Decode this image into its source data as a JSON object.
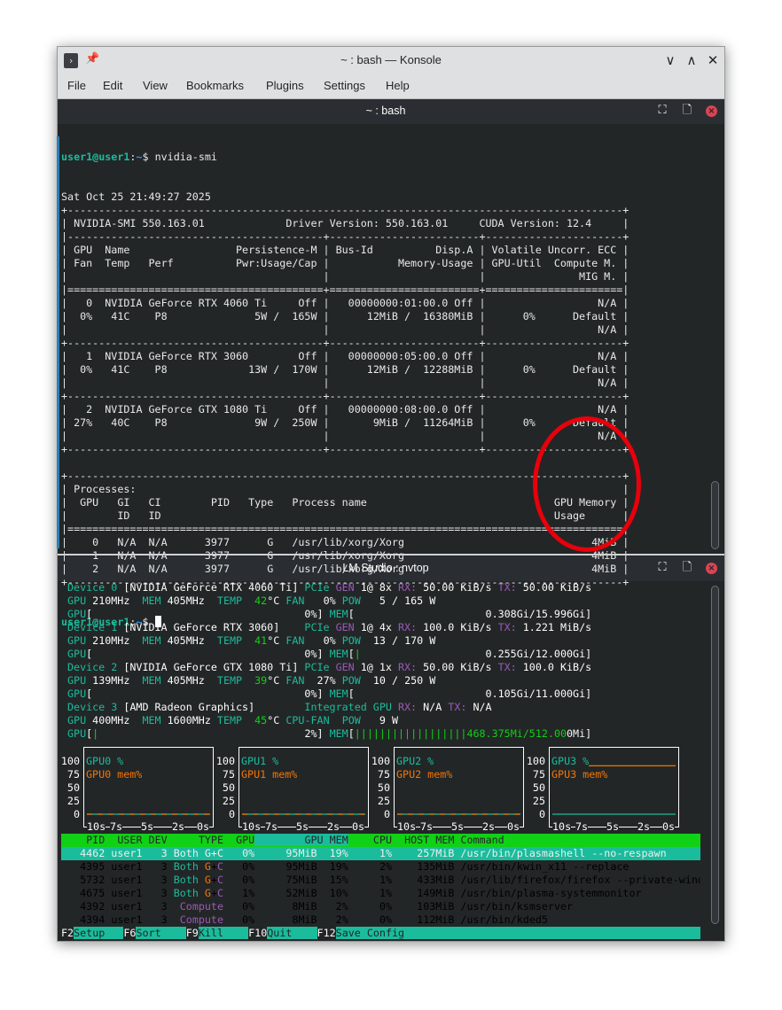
{
  "window": {
    "title": "~ : bash — Konsole",
    "app_icon": "terminal-icon",
    "buttons": [
      "minimize",
      "maximize",
      "close"
    ]
  },
  "menu": [
    "File",
    "Edit",
    "View",
    "Bookmarks",
    "Plugins",
    "Settings",
    "Help"
  ],
  "top_pane": {
    "title": "~ : bash",
    "prompt": {
      "user_host": "user1@user1",
      "sep": ":",
      "path": "~",
      "symbol": "$ ",
      "command": "nvidia-smi"
    },
    "output_lines": [
      "Sat Oct 25 21:49:27 2025",
      "+-----------------------------------------------------------------------------------------+",
      "| NVIDIA-SMI 550.163.01             Driver Version: 550.163.01     CUDA Version: 12.4     |",
      "|-----------------------------------------+------------------------+----------------------+",
      "| GPU  Name                 Persistence-M | Bus-Id          Disp.A | Volatile Uncorr. ECC |",
      "| Fan  Temp   Perf          Pwr:Usage/Cap |           Memory-Usage | GPU-Util  Compute M. |",
      "|                                         |                        |               MIG M. |",
      "|=========================================+========================+======================|",
      "|   0  NVIDIA GeForce RTX 4060 Ti     Off |   00000000:01:00.0 Off |                  N/A |",
      "|  0%   41C    P8              5W /  165W |      12MiB /  16380MiB |      0%      Default |",
      "|                                         |                        |                  N/A |",
      "+-----------------------------------------+------------------------+----------------------+",
      "|   1  NVIDIA GeForce RTX 3060        Off |   00000000:05:00.0 Off |                  N/A |",
      "|  0%   41C    P8             13W /  170W |      12MiB /  12288MiB |      0%      Default |",
      "|                                         |                        |                  N/A |",
      "+-----------------------------------------+------------------------+----------------------+",
      "|   2  NVIDIA GeForce GTX 1080 Ti     Off |   00000000:08:00.0 Off |                  N/A |",
      "| 27%   40C    P8              9W /  250W |       9MiB /  11264MiB |      0%      Default |",
      "|                                         |                        |                  N/A |",
      "+-----------------------------------------+------------------------+----------------------+",
      " ",
      "+-----------------------------------------------------------------------------------------+",
      "| Processes:                                                                              |",
      "|  GPU   GI   CI        PID   Type   Process name                              GPU Memory |",
      "|        ID   ID                                                               Usage      |",
      "|=========================================================================================|",
      "|    0   N/A  N/A      3977      G   /usr/lib/xorg/Xorg                              4MiB |",
      "|    1   N/A  N/A      3977      G   /usr/lib/xorg/Xorg                              4MiB |",
      "|    2   N/A  N/A      3977      G   /usr/lib/xorg/Xorg                              4MiB |",
      "+-----------------------------------------------------------------------------------------+"
    ]
  },
  "annotation": {
    "shape": "ellipse",
    "color": "#e8000b",
    "highlights": "GPU Memory Usage"
  },
  "bottom_pane": {
    "title": "LM Studio : nvtop",
    "devices": [
      {
        "header": [
          [
            "Device 0",
            "t"
          ],
          [
            " [NVIDIA GeForce RTX 4060 Ti] ",
            "w"
          ],
          [
            "PCIe ",
            "t"
          ],
          [
            "GEN ",
            "p"
          ],
          [
            "1@ 8x ",
            "w"
          ],
          [
            "RX:",
            "p"
          ],
          [
            " 50.00 KiB/s ",
            "w"
          ],
          [
            "TX:",
            "p"
          ],
          [
            " 50.00 KiB/s",
            "w"
          ]
        ],
        "stats": [
          [
            "GPU ",
            "t"
          ],
          [
            "210MHz  ",
            "w"
          ],
          [
            "MEM ",
            "t"
          ],
          [
            "405MHz  ",
            "w"
          ],
          [
            "TEMP  ",
            "t"
          ],
          [
            "42",
            "g"
          ],
          [
            "°C ",
            "w"
          ],
          [
            "FAN ",
            "t"
          ],
          [
            "  0% ",
            "w"
          ],
          [
            "POW ",
            "t"
          ],
          [
            "  5 / 165 W",
            "w"
          ]
        ],
        "bars": {
          "gpu_util_pct": 0,
          "gpu_text": "0%",
          "mem_bar_pct": 0,
          "mem_text": "0.308Gi/15.996Gi"
        }
      },
      {
        "header": [
          [
            "Device 1",
            "t"
          ],
          [
            " [NVIDIA GeForce RTX 3060]    ",
            "w"
          ],
          [
            "PCIe ",
            "t"
          ],
          [
            "GEN ",
            "p"
          ],
          [
            "1@ 4x ",
            "w"
          ],
          [
            "RX:",
            "p"
          ],
          [
            " 100.0 KiB/s ",
            "w"
          ],
          [
            "TX:",
            "p"
          ],
          [
            " 1.221 MiB/s",
            "w"
          ]
        ],
        "stats": [
          [
            "GPU ",
            "t"
          ],
          [
            "210MHz  ",
            "w"
          ],
          [
            "MEM ",
            "t"
          ],
          [
            "405MHz  ",
            "w"
          ],
          [
            "TEMP  ",
            "t"
          ],
          [
            "41",
            "g"
          ],
          [
            "°C ",
            "w"
          ],
          [
            "FAN ",
            "t"
          ],
          [
            "  0% ",
            "w"
          ],
          [
            "POW ",
            "t"
          ],
          [
            " 13 / 170 W",
            "w"
          ]
        ],
        "bars": {
          "gpu_util_pct": 0,
          "gpu_text": "0%",
          "mem_bar_pct": 3,
          "mem_text": "0.255Gi/12.000Gi"
        }
      },
      {
        "header": [
          [
            "Device 2",
            "t"
          ],
          [
            " [NVIDIA GeForce GTX 1080 Ti] ",
            "w"
          ],
          [
            "PCIe ",
            "t"
          ],
          [
            "GEN ",
            "p"
          ],
          [
            "1@ 1x ",
            "w"
          ],
          [
            "RX:",
            "p"
          ],
          [
            " 50.00 KiB/s ",
            "w"
          ],
          [
            "TX:",
            "p"
          ],
          [
            " 100.0 KiB/s",
            "w"
          ]
        ],
        "stats": [
          [
            "GPU ",
            "t"
          ],
          [
            "139MHz  ",
            "w"
          ],
          [
            "MEM ",
            "t"
          ],
          [
            "405MHz  ",
            "w"
          ],
          [
            "TEMP  ",
            "t"
          ],
          [
            "39",
            "g"
          ],
          [
            "°C ",
            "w"
          ],
          [
            "FAN ",
            "t"
          ],
          [
            " 27% ",
            "w"
          ],
          [
            "POW ",
            "t"
          ],
          [
            " 10 / 250 W",
            "w"
          ]
        ],
        "bars": {
          "gpu_util_pct": 0,
          "gpu_text": "0%",
          "mem_bar_pct": 0,
          "mem_text": "0.105Gi/11.000Gi"
        }
      },
      {
        "header": [
          [
            "Device 3",
            "t"
          ],
          [
            " [AMD Radeon Graphics]        ",
            "w"
          ],
          [
            "Integrated GPU ",
            "t"
          ],
          [
            "RX:",
            "p"
          ],
          [
            " N/A ",
            "w"
          ],
          [
            "TX:",
            "p"
          ],
          [
            " N/A",
            "w"
          ]
        ],
        "stats": [
          [
            "GPU ",
            "t"
          ],
          [
            "400MHz  ",
            "w"
          ],
          [
            "MEM ",
            "t"
          ],
          [
            "1600MHz ",
            "w"
          ],
          [
            "TEMP  ",
            "t"
          ],
          [
            "45",
            "g"
          ],
          [
            "°C ",
            "w"
          ],
          [
            "CPU-FAN  ",
            "t"
          ],
          [
            "POW ",
            "t"
          ],
          [
            "  9 W",
            "w"
          ]
        ],
        "bars": {
          "gpu_util_pct": 2,
          "gpu_text": "2%",
          "mem_bar_pct": 91,
          "mem_text": "468.375Mi/512.000Mi"
        }
      }
    ],
    "charts": [
      {
        "legend": [
          "GPU0 %",
          "GPU0 mem%"
        ],
        "y_ticks": [
          "100",
          "75",
          "50",
          "25",
          "0"
        ],
        "x_ticks": [
          "10s",
          "7s",
          "5s",
          "2s",
          "0s"
        ],
        "ylim": [
          0,
          100
        ],
        "gpu_pct": 0,
        "mem_pct": 0
      },
      {
        "legend": [
          "GPU1 %",
          "GPU1 mem%"
        ],
        "y_ticks": [
          "100",
          "75",
          "50",
          "25",
          "0"
        ],
        "x_ticks": [
          "10s",
          "7s",
          "5s",
          "2s",
          "0s"
        ],
        "ylim": [
          0,
          100
        ],
        "gpu_pct": 0,
        "mem_pct": 0
      },
      {
        "legend": [
          "GPU2 %",
          "GPU2 mem%"
        ],
        "y_ticks": [
          "100",
          "75",
          "50",
          "25",
          "0"
        ],
        "x_ticks": [
          "10s",
          "7s",
          "5s",
          "2s",
          "0s"
        ],
        "ylim": [
          0,
          100
        ],
        "gpu_pct": 0,
        "mem_pct": 0
      },
      {
        "legend": [
          "GPU3 %",
          "GPU3 mem%"
        ],
        "y_ticks": [
          "100",
          "75",
          "50",
          "25",
          "0"
        ],
        "x_ticks": [
          "10s",
          "7s",
          "5s",
          "2s",
          "0s"
        ],
        "ylim": [
          0,
          100
        ],
        "gpu_pct": 0,
        "mem_pct": 91
      }
    ],
    "process_table": {
      "headers": [
        "PID",
        "USER",
        "DEV",
        "TYPE",
        "GPU",
        "GPU MEM",
        "CPU",
        "HOST MEM",
        "Command"
      ],
      "rows": [
        {
          "pid": "4462",
          "user": "user1",
          "dev": "3",
          "type": "Both G+C",
          "gpu": "0%",
          "gpu_mem": "95MiB",
          "mem_pct": "19%",
          "cpu": "1%",
          "host_mem": "257MiB",
          "command": "/usr/bin/plasmashell --no-respawn",
          "selected": true
        },
        {
          "pid": "4395",
          "user": "user1",
          "dev": "3",
          "type": "Both G+C",
          "gpu": "0%",
          "gpu_mem": "95MiB",
          "mem_pct": "19%",
          "cpu": "2%",
          "host_mem": "135MiB",
          "command": "/usr/bin/kwin_x11 --replace",
          "selected": false
        },
        {
          "pid": "5732",
          "user": "user1",
          "dev": "3",
          "type": "Both G+C",
          "gpu": "0%",
          "gpu_mem": "75MiB",
          "mem_pct": "15%",
          "cpu": "1%",
          "host_mem": "433MiB",
          "command": "/usr/lib/firefox/firefox --private-wind",
          "selected": false
        },
        {
          "pid": "4675",
          "user": "user1",
          "dev": "3",
          "type": "Both G+C",
          "gpu": "1%",
          "gpu_mem": "52MiB",
          "mem_pct": "10%",
          "cpu": "1%",
          "host_mem": "149MiB",
          "command": "/usr/bin/plasma-systemmonitor",
          "selected": false
        },
        {
          "pid": "4392",
          "user": "user1",
          "dev": "3",
          "type": "Compute",
          "gpu": "0%",
          "gpu_mem": "8MiB",
          "mem_pct": "2%",
          "cpu": "0%",
          "host_mem": "103MiB",
          "command": "/usr/bin/ksmserver",
          "selected": false
        },
        {
          "pid": "4394",
          "user": "user1",
          "dev": "3",
          "type": "Compute",
          "gpu": "0%",
          "gpu_mem": "8MiB",
          "mem_pct": "2%",
          "cpu": "0%",
          "host_mem": "112MiB",
          "command": "/usr/bin/kded5",
          "selected": false
        }
      ]
    },
    "footer": [
      {
        "key": "F2",
        "label": "Setup"
      },
      {
        "key": "F6",
        "label": "Sort"
      },
      {
        "key": "F9",
        "label": "Kill"
      },
      {
        "key": "F10",
        "label": "Quit"
      },
      {
        "key": "F12",
        "label": "Save Config"
      }
    ]
  },
  "colors": {
    "terminal_bg": "#232627",
    "teal": "#1abc9c",
    "purple": "#9b59b6",
    "green": "#11d116",
    "orange": "#f67400",
    "header_green": "#11d116",
    "close_red": "#da4453"
  }
}
